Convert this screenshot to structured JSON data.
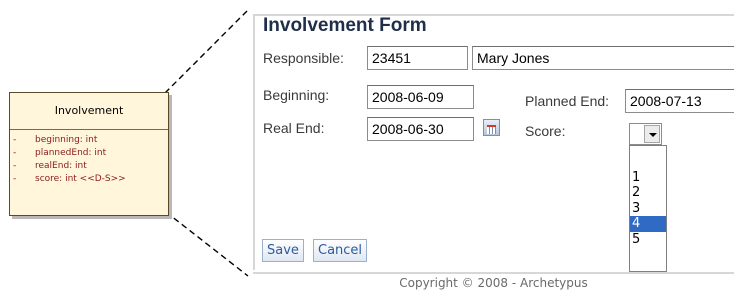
{
  "uml": {
    "title": "Involvement",
    "attributes": [
      {
        "visibility": "-",
        "text": "beginning: int"
      },
      {
        "visibility": "-",
        "text": "plannedEnd: int"
      },
      {
        "visibility": "-",
        "text": "realEnd: int"
      },
      {
        "visibility": "-",
        "text": "score: int  <<D-S>>"
      }
    ]
  },
  "form": {
    "title": "Involvement Form",
    "responsible_label": "Responsible:",
    "responsible_id": "23451",
    "responsible_name": "Mary Jones",
    "beginning_label": "Beginning:",
    "beginning_value": "2008-06-09",
    "planned_end_label": "Planned End:",
    "planned_end_value": "2008-07-13",
    "real_end_label": "Real End:",
    "real_end_value": "2008-06-30",
    "score_label": "Score:",
    "score_selected": "",
    "score_options": [
      "",
      "1",
      "2",
      "3",
      "4",
      "5"
    ],
    "score_highlighted": "4",
    "save_label": "Save",
    "cancel_label": "Cancel",
    "footer": "Copyright © 2008 - Archetypus"
  },
  "icons": {
    "calendar": "calendar-icon",
    "dropdown": "chevron-down-icon"
  },
  "colors": {
    "uml_fill": "#fff6dc",
    "uml_attr_text": "#8b1a1a",
    "form_title": "#1f2f4a",
    "selected_option": "#316ac5",
    "button_text": "#2c5b9e"
  }
}
